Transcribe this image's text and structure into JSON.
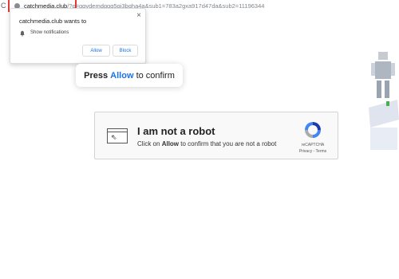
{
  "browser": {
    "reload_glyph": "C",
    "url_host": "catchmedia.club",
    "url_path": "/?p=gqydemdggq5gi3bqha4a&sub1=783a2gxa917d47da&sub2=11196344"
  },
  "notification": {
    "title": "catchmedia.club wants to",
    "close_glyph": "×",
    "message": "Show notifications",
    "allow_label": "Allow",
    "block_label": "Block"
  },
  "press_banner": {
    "prefix": "Press",
    "allow": "Allow",
    "suffix": "to confirm"
  },
  "captcha": {
    "title": "I am not a robot",
    "sub_prefix": "Click on",
    "sub_bold": "Allow",
    "sub_suffix": "to confirm that you are not a robot",
    "brand": "reCAPTCHA",
    "links": "Privacy - Terms"
  },
  "colors": {
    "accent": "#1a73e8",
    "highlight_frame": "#e53935",
    "captcha_bg": "#f9f9f9"
  },
  "icons": [
    "reload-icon",
    "site-info-icon",
    "close-icon",
    "bell-icon",
    "window-cursor-icon",
    "recaptcha-logo-icon"
  ]
}
